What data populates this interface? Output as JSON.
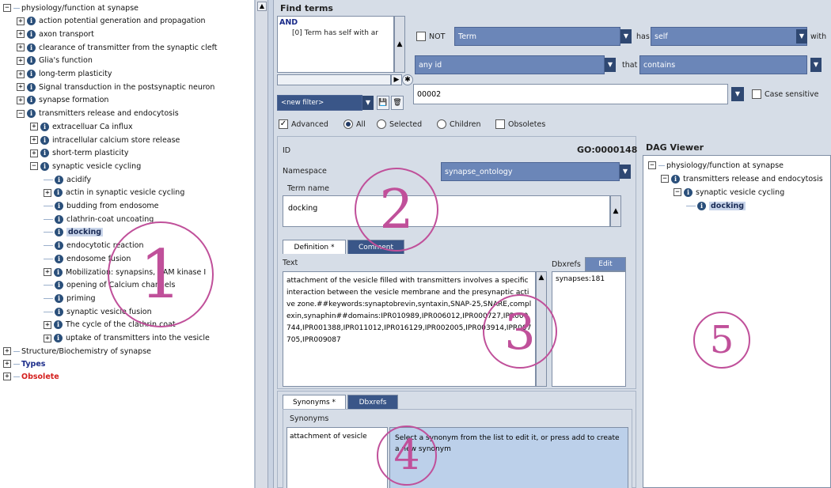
{
  "tree": {
    "items": [
      {
        "label": "physiology/function at synapse",
        "toggle": "−",
        "info": false
      },
      {
        "label": "action potential generation and propagation",
        "toggle": "+",
        "info": true
      },
      {
        "label": "axon transport",
        "toggle": "+",
        "info": true
      },
      {
        "label": "clearance of transmitter from the synaptic cleft",
        "toggle": "+",
        "info": true
      },
      {
        "label": "Glia's function",
        "toggle": "+",
        "info": true
      },
      {
        "label": "long-term plasticity",
        "toggle": "+",
        "info": true
      },
      {
        "label": "Signal transduction in the postsynaptic neuron",
        "toggle": "+",
        "info": true
      },
      {
        "label": "synapse formation",
        "toggle": "+",
        "info": true
      },
      {
        "label": "transmitters release and endocytosis",
        "toggle": "−",
        "info": true
      },
      {
        "label": "extracelluar Ca influx",
        "toggle": "+",
        "info": true
      },
      {
        "label": "intracellular calcium store release",
        "toggle": "+",
        "info": true
      },
      {
        "label": "short-term plasticity",
        "toggle": "+",
        "info": true
      },
      {
        "label": "synaptic vesicle cycling",
        "toggle": "−",
        "info": true
      },
      {
        "label": "acidify",
        "toggle": "",
        "info": true
      },
      {
        "label": "actin in synaptic vesicle cycling",
        "toggle": "+",
        "info": true
      },
      {
        "label": "budding from endosome",
        "toggle": "",
        "info": true
      },
      {
        "label": "clathrin-coat uncoating",
        "toggle": "",
        "info": true
      },
      {
        "label": "docking",
        "toggle": "",
        "info": true
      },
      {
        "label": "endocytotic reaction",
        "toggle": "",
        "info": true
      },
      {
        "label": "endosome fusion",
        "toggle": "",
        "info": true
      },
      {
        "label": "Mobilization: synapsins, CAM kinase I",
        "toggle": "+",
        "info": true
      },
      {
        "label": "opening of Calcium channels",
        "toggle": "",
        "info": true
      },
      {
        "label": "priming",
        "toggle": "",
        "info": true
      },
      {
        "label": "synaptic vesicle fusion",
        "toggle": "",
        "info": true
      },
      {
        "label": "The cycle of the clathrin coat",
        "toggle": "+",
        "info": true
      },
      {
        "label": "uptake of transmitters into the vesicle",
        "toggle": "+",
        "info": true
      },
      {
        "label": "Structure/Biochemistry of synapse",
        "toggle": "+",
        "info": false
      },
      {
        "label": "Types",
        "toggle": "+",
        "info": false
      },
      {
        "label": "Obsolete",
        "toggle": "+",
        "info": false
      }
    ]
  },
  "find_terms": {
    "title": "Find terms",
    "logic": "AND",
    "filter_item": "[0] Term has self with ar",
    "not_label": "NOT",
    "term_field": "Term",
    "has_label": "has",
    "self_field": "self",
    "with_label": "with",
    "id_field": "any id",
    "that_label": "that",
    "contains_field": "contains",
    "new_filter": "<new filter>",
    "search_value": "00002",
    "case_sensitive": "Case sensitive",
    "advanced": "Advanced",
    "all": "All",
    "selected": "Selected",
    "children": "Children",
    "obsoletes": "Obsoletes"
  },
  "term_editor": {
    "id_label": "ID",
    "id_value": "GO:0000148",
    "namespace_label": "Namespace",
    "namespace_value": "synapse_ontology",
    "term_name_label": "Term name",
    "term_name_value": "docking",
    "tabs": [
      "Definition *",
      "Comment"
    ],
    "text_label": "Text",
    "definition": "attachment of the vesicle filled with transmitters involves a specific interaction between the vesicle membrane and the presynaptic active zone.##keywords:synaptobrevin,syntaxin,SNAP-25,SNARE,complexin,synaphin##domains:IPR010989,IPR006012,IPR000727,IPR000744,IPR001388,IPR011012,IPR016129,IPR002005,IPR003914,IPR007705,IPR009087",
    "dbxrefs_label": "Dbxrefs",
    "edit_label": "Edit",
    "dbxref_value": "synapses:181"
  },
  "synonyms": {
    "tabs": [
      "Synonyms *",
      "Dbxrefs"
    ],
    "group_label": "Synonyms",
    "item": "attachment of vesicle",
    "hint": "Select a synonym from the list to edit it, or press add to create a new synonym"
  },
  "dag": {
    "title": "DAG Viewer",
    "items": [
      {
        "label": "physiology/function at synapse",
        "toggle": "−",
        "info": false
      },
      {
        "label": "transmitters release and endocytosis",
        "toggle": "−",
        "info": true
      },
      {
        "label": "synaptic vesicle cycling",
        "toggle": "−",
        "info": true
      },
      {
        "label": "docking",
        "toggle": "",
        "info": true
      }
    ]
  },
  "annotations": [
    "1",
    "2",
    "3",
    "4",
    "5"
  ],
  "colors": {
    "annotation": "#c0509a",
    "field": "#6b86b8",
    "selected": "#c9d5ea"
  }
}
